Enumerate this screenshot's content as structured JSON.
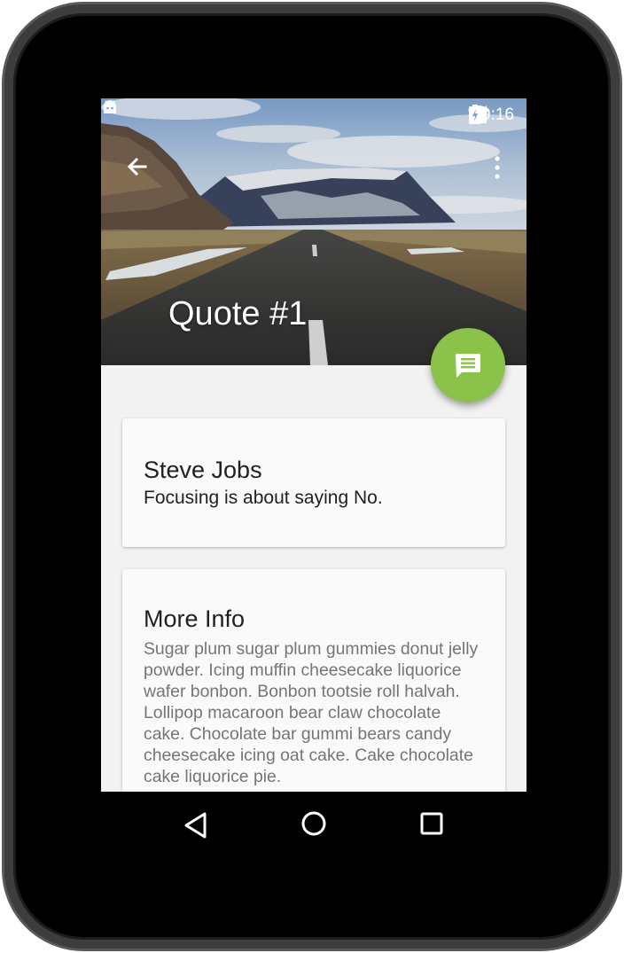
{
  "status_bar": {
    "time": "9:16"
  },
  "app_bar": {
    "title": "Quote #1"
  },
  "quote_card": {
    "author": "Steve Jobs",
    "quote": "Focusing is about saying No."
  },
  "info_card": {
    "title": "More Info",
    "body": "Sugar plum sugar plum gummies donut jelly powder. Icing muffin cheesecake liquorice wafer bonbon. Bonbon tootsie roll halvah. Lollipop macaroon bear claw chocolate cake. Chocolate bar gummi bears candy cheesecake icing oat cake. Cake chocolate cake liquorice pie."
  },
  "colors": {
    "fab": "#8bc34a",
    "card_bg": "#fafafa",
    "screen_bg": "#f2f2f2"
  }
}
